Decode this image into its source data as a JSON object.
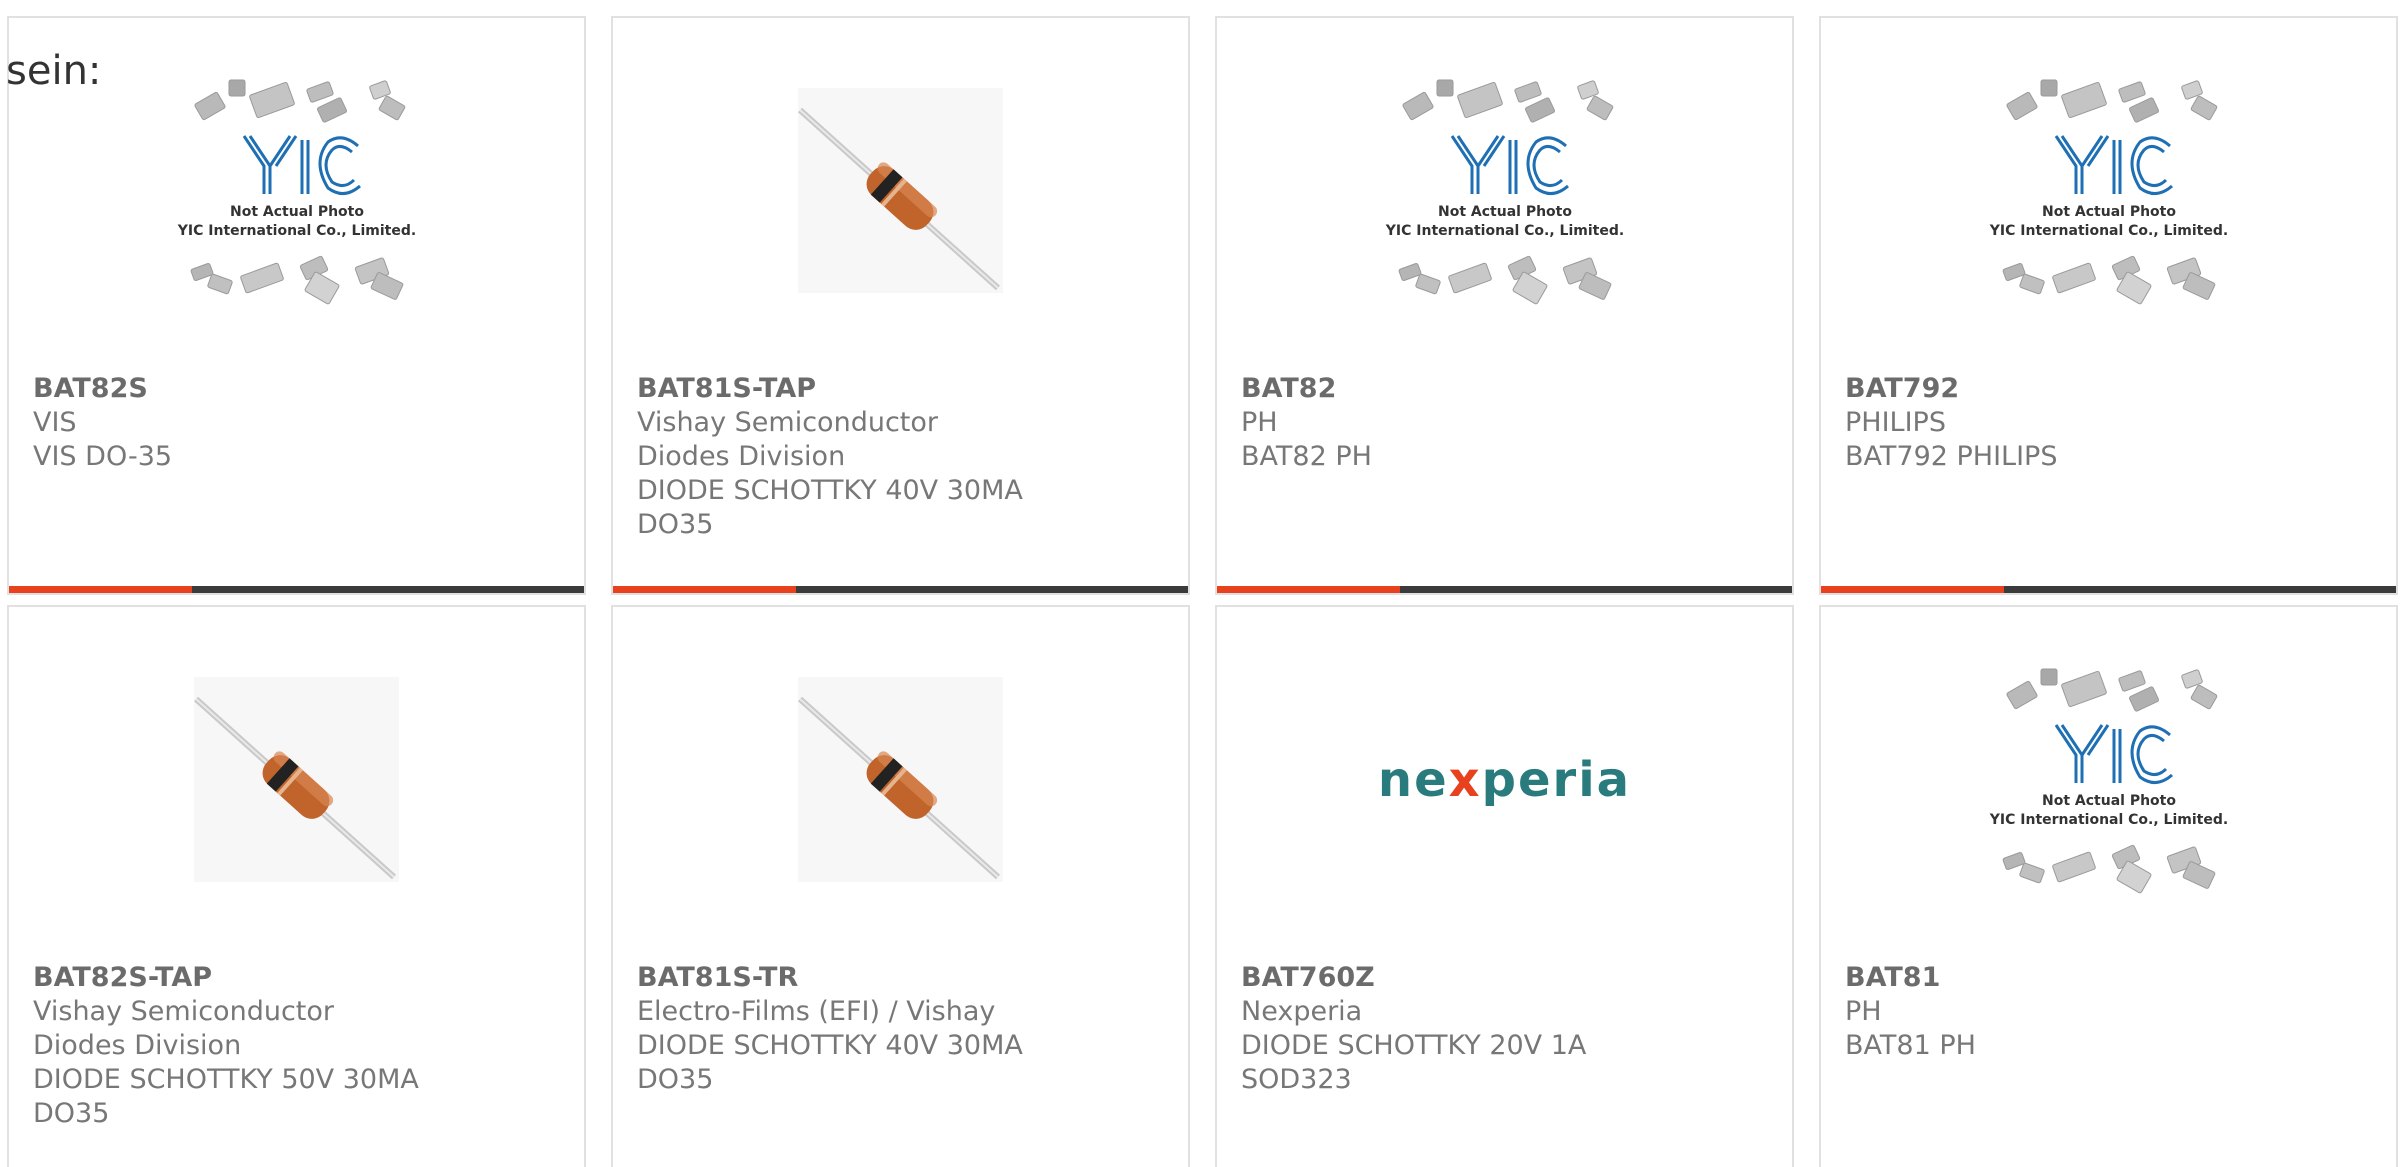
{
  "page": {
    "lead_text": "sein:"
  },
  "products": [
    {
      "part": "BAT82S",
      "manufacturer": "VIS",
      "description": "VIS DO-35",
      "image": "yic-placeholder",
      "photo_note": "Not Actual Photo",
      "company": "YIC International Co., Limited."
    },
    {
      "part": "BAT81S-TAP",
      "manufacturer": "Vishay Semiconductor Diodes Division",
      "description": "DIODE SCHOTTKY 40V 30MA DO35",
      "image": "diode-axial"
    },
    {
      "part": "BAT82",
      "manufacturer": "PH",
      "description": "BAT82 PH",
      "image": "yic-placeholder",
      "photo_note": "Not Actual Photo",
      "company": "YIC International Co., Limited."
    },
    {
      "part": "BAT792",
      "manufacturer": "PHILIPS",
      "description": "BAT792 PHILIPS",
      "image": "yic-placeholder",
      "photo_note": "Not Actual Photo",
      "company": "YIC International Co., Limited."
    },
    {
      "part": "BAT82S-TAP",
      "manufacturer": "Vishay Semiconductor Diodes Division",
      "description": "DIODE SCHOTTKY 50V 30MA DO35",
      "image": "diode-axial"
    },
    {
      "part": "BAT81S-TR",
      "manufacturer": "Electro-Films (EFI) / Vishay",
      "description": "DIODE SCHOTTKY 40V 30MA DO35",
      "image": "diode-axial"
    },
    {
      "part": "BAT760Z",
      "manufacturer": "Nexperia",
      "description": "DIODE SCHOTTKY 20V 1A SOD323",
      "image": "nexperia-logo",
      "logo_text_before": "ne",
      "logo_text_x": "x",
      "logo_text_after": "peria"
    },
    {
      "part": "BAT81",
      "manufacturer": "PH",
      "description": "BAT81 PH",
      "image": "yic-placeholder",
      "photo_note": "Not Actual Photo",
      "company": "YIC International Co., Limited."
    }
  ],
  "colors": {
    "accent": "#e8411d",
    "bar": "#3b3b3b",
    "border": "#e1e1e1",
    "yic_blue": "#1f6fb4",
    "nexperia_teal": "#2a7b7e"
  }
}
